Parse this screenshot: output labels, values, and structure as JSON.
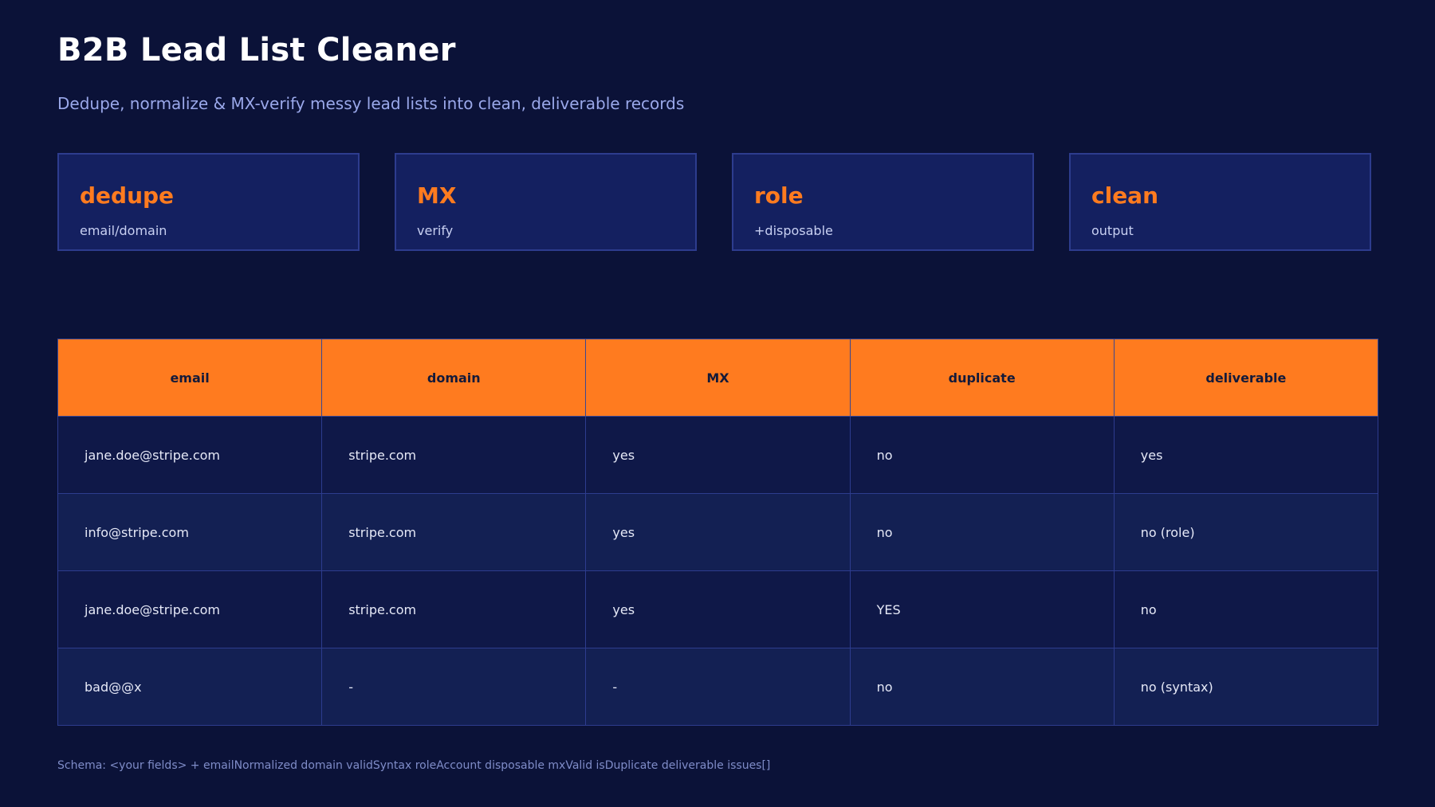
{
  "header": {
    "title": "B2B Lead List Cleaner",
    "subtitle": "Dedupe, normalize & MX-verify messy lead lists into clean, deliverable records"
  },
  "cards": [
    {
      "title": "dedupe",
      "sub": "email/domain"
    },
    {
      "title": "MX",
      "sub": "verify"
    },
    {
      "title": "role",
      "sub": "+disposable"
    },
    {
      "title": "clean",
      "sub": "output"
    }
  ],
  "table": {
    "columns": [
      "email",
      "domain",
      "MX",
      "duplicate",
      "deliverable"
    ],
    "rows": [
      [
        "jane.doe@stripe.com",
        "stripe.com",
        "yes",
        "no",
        "yes"
      ],
      [
        "info@stripe.com",
        "stripe.com",
        "yes",
        "no",
        "no (role)"
      ],
      [
        "jane.doe@stripe.com",
        "stripe.com",
        "yes",
        "YES",
        "no"
      ],
      [
        "bad@@x",
        "-",
        "-",
        "no",
        "no (syntax)"
      ]
    ]
  },
  "footer": {
    "schema": "Schema: <your fields> + emailNormalized domain validSyntax roleAccount disposable mxValid isDuplicate deliverable issues[]"
  },
  "colors": {
    "background": "#0b1238",
    "accent": "#ff7b1f",
    "card": "#142060",
    "border": "#2d3c8e"
  }
}
